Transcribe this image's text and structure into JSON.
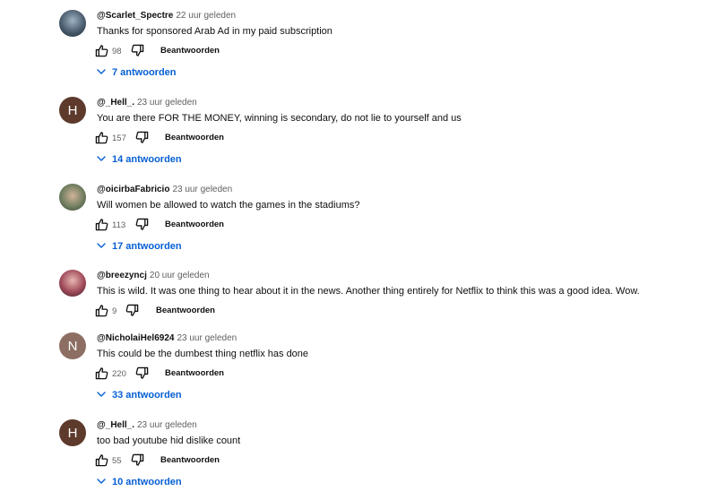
{
  "comments": [
    {
      "author": "@Scarlet_Spectre",
      "time": "22 uur geleden",
      "text": "Thanks for sponsored Arab Ad in my paid subscription",
      "likes": "98",
      "reply_label": "Beantwoorden",
      "replies": "7 antwoorden",
      "avatar": ""
    },
    {
      "author": "@_Hell_.",
      "time": "23 uur geleden",
      "text": "You are there FOR THE MONEY, winning is secondary, do not lie to yourself and us",
      "likes": "157",
      "reply_label": "Beantwoorden",
      "replies": "14 antwoorden",
      "avatar": "H"
    },
    {
      "author": "@oicirbaFabricio",
      "time": "23 uur geleden",
      "text": "Will women be allowed to watch the games in the stadiums?",
      "likes": "113",
      "reply_label": "Beantwoorden",
      "replies": "17 antwoorden",
      "avatar": ""
    },
    {
      "author": "@breezyncj",
      "time": "20 uur geleden",
      "text": "This is wild. It was one thing to hear about it in the news. Another thing entirely for Netflix to think this was a good idea. Wow.",
      "likes": "9",
      "reply_label": "Beantwoorden",
      "replies": "",
      "avatar": ""
    },
    {
      "author": "@NicholaiHel6924",
      "time": "23 uur geleden",
      "text": "This could be the dumbest thing netflix has done",
      "likes": "220",
      "reply_label": "Beantwoorden",
      "replies": "33 antwoorden",
      "avatar": "N"
    },
    {
      "author": "@_Hell_.",
      "time": "23 uur geleden",
      "text": "too bad youtube hid dislike count",
      "likes": "55",
      "reply_label": "Beantwoorden",
      "replies": "10 antwoorden",
      "avatar": "H"
    }
  ],
  "icons": {
    "like": "thumbs-up-icon",
    "dislike": "thumbs-down-icon",
    "expand": "chevron-down-icon"
  },
  "colors": {
    "link": "#065fd4",
    "meta": "#606060"
  }
}
